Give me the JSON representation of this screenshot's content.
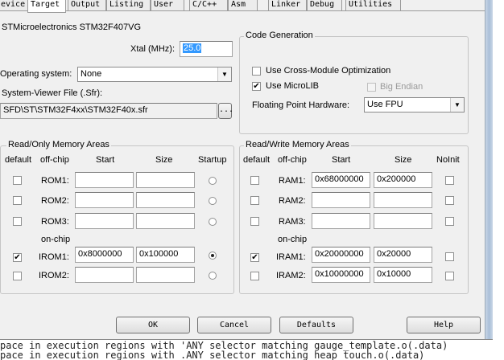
{
  "tabs": [
    "evice",
    "Target",
    "Output",
    "Listing",
    "User",
    "C/C++",
    "Asm",
    "Linker",
    "Debug",
    "Utilities"
  ],
  "device": {
    "name": "STMicroelectronics STM32F407VG",
    "xtal_label": "Xtal (MHz):",
    "xtal_value": "25.0",
    "os_label": "Operating system:",
    "os_value": "None",
    "svd_label": "System-Viewer File (.Sfr):",
    "svd_value": "SFD\\ST\\STM32F4xx\\STM32F40x.sfr",
    "browse_label": "..."
  },
  "codegen": {
    "title": "Code Generation",
    "cross_module": {
      "label": "Use Cross-Module Optimization",
      "checked": false
    },
    "microlib": {
      "label": "Use MicroLIB",
      "checked": true
    },
    "big_endian": {
      "label": "Big Endian",
      "checked": false
    },
    "fpu_label": "Floating Point Hardware:",
    "fpu_value": "Use FPU"
  },
  "rom": {
    "title": "Read/Only Memory Areas",
    "headers": {
      "default": "default",
      "offchip": "off-chip",
      "start": "Start",
      "size": "Size",
      "startup": "Startup"
    },
    "onchip_label": "on-chip",
    "rows": [
      {
        "name": "ROM1:",
        "start": "",
        "size": "",
        "default": false,
        "startup": false
      },
      {
        "name": "ROM2:",
        "start": "",
        "size": "",
        "default": false,
        "startup": false
      },
      {
        "name": "ROM3:",
        "start": "",
        "size": "",
        "default": false,
        "startup": false
      },
      {
        "name": "IROM1:",
        "start": "0x8000000",
        "size": "0x100000",
        "default": true,
        "startup": true
      },
      {
        "name": "IROM2:",
        "start": "",
        "size": "",
        "default": false,
        "startup": false
      }
    ]
  },
  "ram": {
    "title": "Read/Write Memory Areas",
    "headers": {
      "default": "default",
      "offchip": "off-chip",
      "start": "Start",
      "size": "Size",
      "noinit": "NoInit"
    },
    "onchip_label": "on-chip",
    "rows": [
      {
        "name": "RAM1:",
        "start": "0x68000000",
        "size": "0x200000",
        "default": false,
        "noinit": false
      },
      {
        "name": "RAM2:",
        "start": "",
        "size": "",
        "default": false,
        "noinit": false
      },
      {
        "name": "RAM3:",
        "start": "",
        "size": "",
        "default": false,
        "noinit": false
      },
      {
        "name": "IRAM1:",
        "start": "0x20000000",
        "size": "0x20000",
        "default": true,
        "noinit": false
      },
      {
        "name": "IRAM2:",
        "start": "0x10000000",
        "size": "0x10000",
        "default": false,
        "noinit": false
      }
    ]
  },
  "buttons": {
    "ok": "OK",
    "cancel": "Cancel",
    "defaults": "Defaults",
    "help": "Help"
  },
  "background_text": [
    "pace in execution regions with 'ANY selector matching gauge_template.o(.data)",
    "pace in execution regions with .ANY selector matching heap_touch.o(.data)"
  ]
}
